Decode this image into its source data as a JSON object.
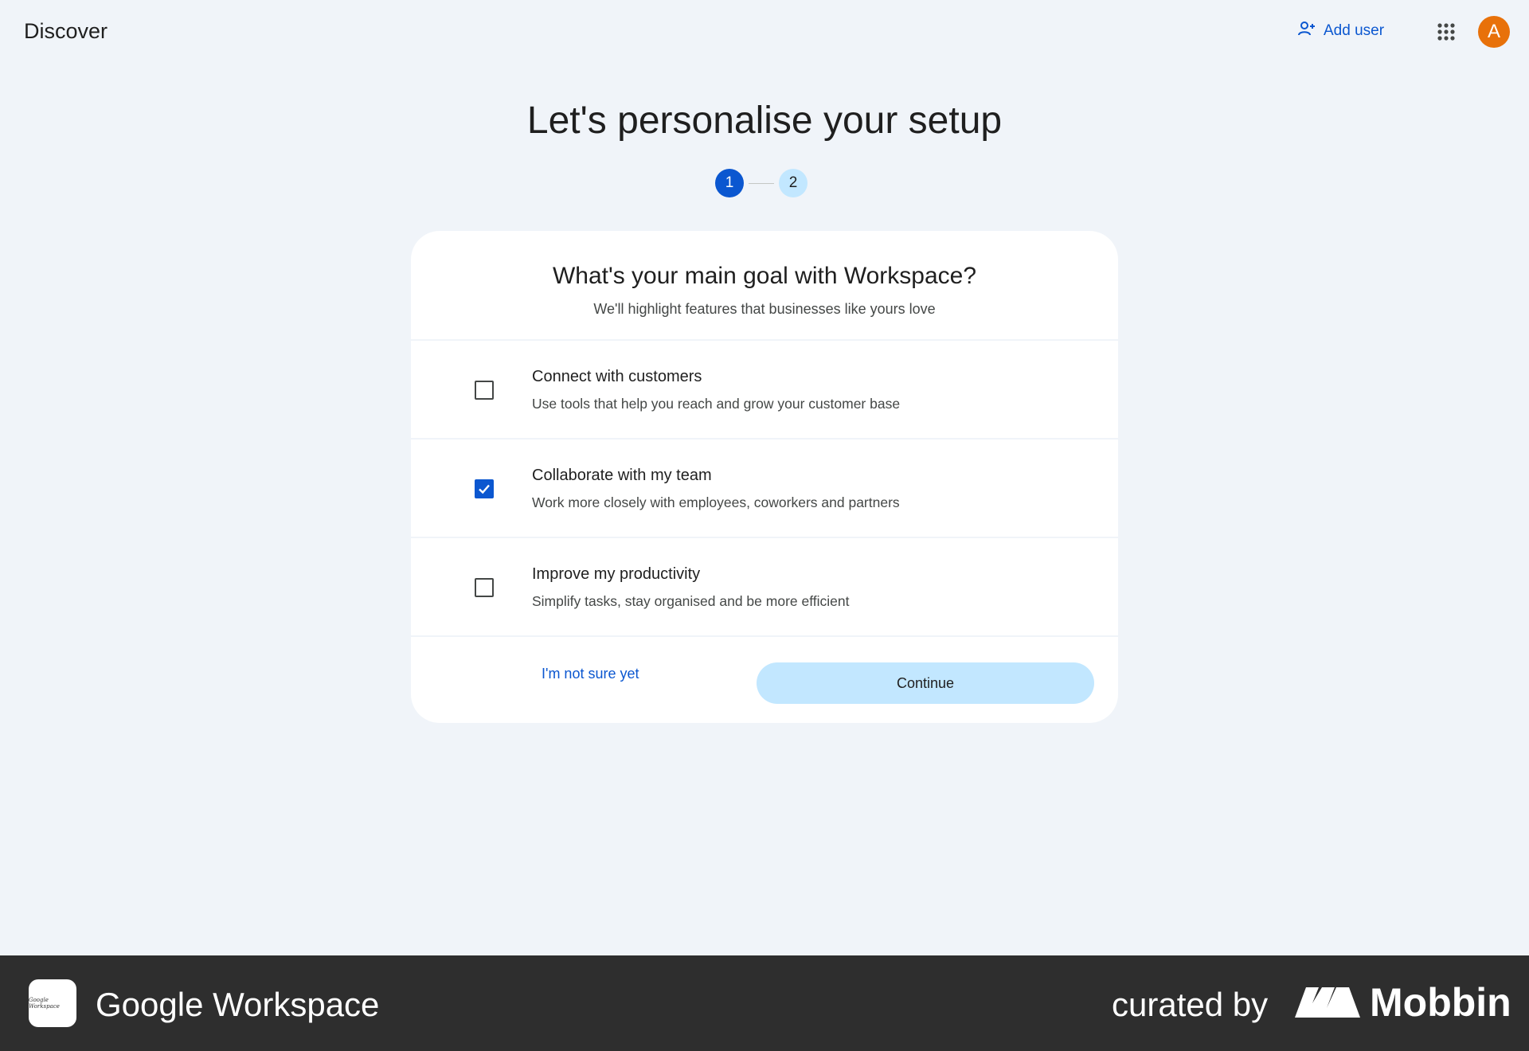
{
  "header": {
    "app_title": "Discover",
    "add_user_label": "Add user",
    "avatar_initial": "A"
  },
  "page": {
    "title": "Let's personalise your setup"
  },
  "stepper": {
    "steps": [
      "1",
      "2"
    ],
    "current_step": 1
  },
  "card": {
    "title": "What's your main goal with Workspace?",
    "subtitle": "We'll highlight features that businesses like yours love",
    "options": [
      {
        "title": "Connect with customers",
        "description": "Use tools that help you reach and grow your customer base",
        "checked": false
      },
      {
        "title": "Collaborate with my team",
        "description": "Work more closely with employees, coworkers and partners",
        "checked": true
      },
      {
        "title": "Improve my productivity",
        "description": "Simplify tasks, stay organised and be more efficient",
        "checked": false
      }
    ],
    "secondary_action": "I'm not sure yet",
    "primary_action": "Continue"
  },
  "footer": {
    "app_name": "Google Workspace",
    "logo_text": "Google Workspace",
    "curated_by": "curated by",
    "brand": "Mobbin"
  },
  "colors": {
    "background": "#f0f4f9",
    "primary": "#0b57d0",
    "primary_container": "#c2e7ff",
    "avatar": "#e8710a",
    "footer": "#2e2e2e"
  },
  "icons": [
    "person-add-icon",
    "apps-grid-icon",
    "check-icon",
    "mobbin-logo-icon"
  ]
}
